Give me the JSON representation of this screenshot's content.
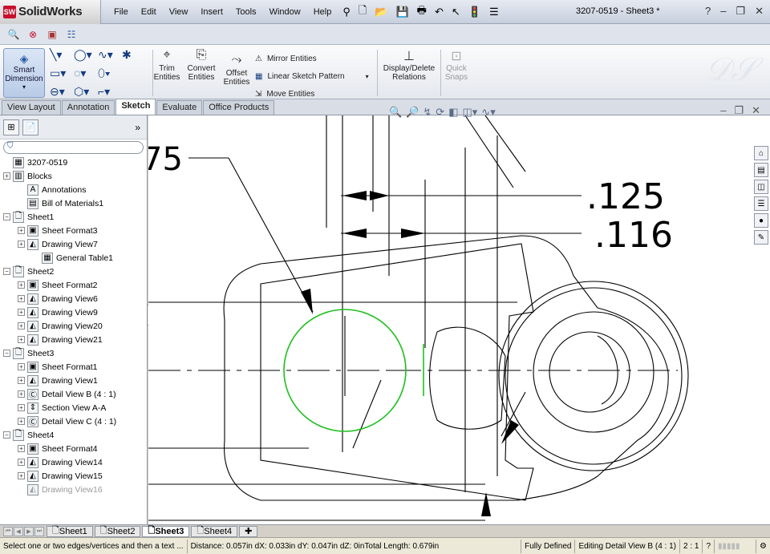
{
  "app": {
    "brand": "SolidWorks",
    "brand_mark": "SW",
    "document_title": "3207-0519 - Sheet3 *"
  },
  "menu": [
    "File",
    "Edit",
    "View",
    "Insert",
    "Tools",
    "Window",
    "Help"
  ],
  "commands": {
    "smart_dimension": [
      "Smart",
      "Dimension"
    ],
    "trim": [
      "Trim",
      "Entities"
    ],
    "convert": [
      "Convert",
      "Entities"
    ],
    "offset": [
      "Offset",
      "Entities"
    ],
    "mirror": "Mirror Entities",
    "linear_pattern": "Linear Sketch Pattern",
    "move": "Move Entities",
    "relations": [
      "Display/Delete",
      "Relations"
    ],
    "quick_snaps": [
      "Quick",
      "Snaps"
    ]
  },
  "tabs": [
    "View Layout",
    "Annotation",
    "Sketch",
    "Evaluate",
    "Office Products"
  ],
  "active_tab": "Sketch",
  "tree": [
    {
      "label": "3207-0519",
      "level": 0,
      "exp": "",
      "icon": "drawing-icon"
    },
    {
      "label": "Blocks",
      "level": 0,
      "exp": "+",
      "icon": "blocks-icon"
    },
    {
      "label": "Annotations",
      "level": 1,
      "exp": "",
      "icon": "annotations-icon"
    },
    {
      "label": "Bill of Materials1",
      "level": 1,
      "exp": "",
      "icon": "bom-icon"
    },
    {
      "label": "Sheet1",
      "level": 0,
      "exp": "−",
      "icon": "sheet-icon"
    },
    {
      "label": "Sheet Format3",
      "level": 1,
      "exp": "+",
      "icon": "sheet-format-icon"
    },
    {
      "label": "Drawing View7",
      "level": 1,
      "exp": "+",
      "icon": "drawing-view-icon"
    },
    {
      "label": "General Table1",
      "level": 2,
      "exp": "",
      "icon": "table-icon"
    },
    {
      "label": "Sheet2",
      "level": 0,
      "exp": "−",
      "icon": "sheet-icon"
    },
    {
      "label": "Sheet Format2",
      "level": 1,
      "exp": "+",
      "icon": "sheet-format-icon"
    },
    {
      "label": "Drawing View6",
      "level": 1,
      "exp": "+",
      "icon": "drawing-view-icon"
    },
    {
      "label": "Drawing View9",
      "level": 1,
      "exp": "+",
      "icon": "drawing-view-icon"
    },
    {
      "label": "Drawing View20",
      "level": 1,
      "exp": "+",
      "icon": "drawing-view-icon"
    },
    {
      "label": "Drawing View21",
      "level": 1,
      "exp": "+",
      "icon": "drawing-view-icon"
    },
    {
      "label": "Sheet3",
      "level": 0,
      "exp": "−",
      "icon": "sheet-icon"
    },
    {
      "label": "Sheet Format1",
      "level": 1,
      "exp": "+",
      "icon": "sheet-format-icon"
    },
    {
      "label": "Drawing View1",
      "level": 1,
      "exp": "+",
      "icon": "drawing-view-icon"
    },
    {
      "label": "Detail View B (4 : 1)",
      "level": 1,
      "exp": "+",
      "icon": "detail-view-icon"
    },
    {
      "label": "Section View A-A",
      "level": 1,
      "exp": "+",
      "icon": "section-view-icon"
    },
    {
      "label": "Detail View C (4 : 1)",
      "level": 1,
      "exp": "+",
      "icon": "detail-view-icon"
    },
    {
      "label": "Sheet4",
      "level": 0,
      "exp": "−",
      "icon": "sheet-icon"
    },
    {
      "label": "Sheet Format4",
      "level": 1,
      "exp": "+",
      "icon": "sheet-format-icon"
    },
    {
      "label": "Drawing View14",
      "level": 1,
      "exp": "+",
      "icon": "drawing-view-icon"
    },
    {
      "label": "Drawing View15",
      "level": 1,
      "exp": "+",
      "icon": "drawing-view-icon"
    },
    {
      "label": "Drawing View16",
      "level": 1,
      "exp": "",
      "icon": "drawing-view-icon",
      "dim": true
    }
  ],
  "drawing": {
    "dim_partial": "75",
    "dim_a": ".125",
    "dim_b": ".116"
  },
  "sheets": [
    "Sheet1",
    "Sheet2",
    "Sheet3",
    "Sheet4"
  ],
  "active_sheet": "Sheet3",
  "status": {
    "prompt": "Select one or two edges/vertices and then a text ...",
    "measure": "Distance: 0.057in  dX: 0.033in  dY: 0.047in  dZ: 0inTotal Length: 0.679in",
    "state": "Fully Defined",
    "editing": "Editing Detail View B (4 : 1)",
    "scale": "2 : 1"
  },
  "colors": {
    "selection_green": "#1fbf1f",
    "accent": "#2458a6"
  }
}
